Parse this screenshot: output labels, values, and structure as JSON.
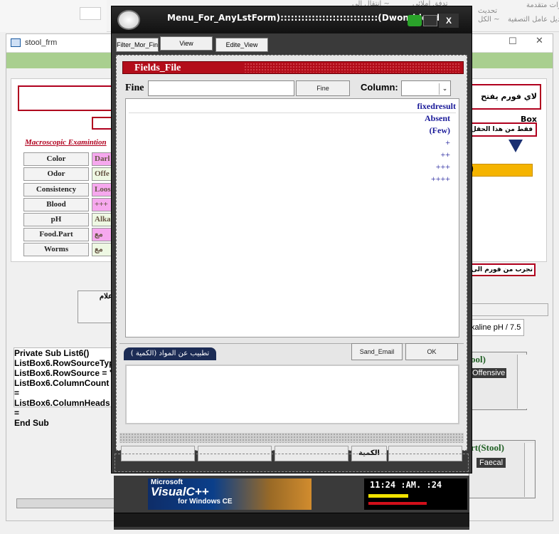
{
  "ribbon": {
    "items": [
      "ارات متقدمة ~",
      "تحديث",
      "الكل ~",
      "تدفق إملائي",
      "انتقال الى ~",
      "ديل عامل التصفية"
    ]
  },
  "stool": {
    "title": "stool_frm",
    "top_right_text": "لاي فورم يفتح Box",
    "field_note": "فقط من هذا الحقل",
    "yellow_text": ")",
    "macro_title": "Macroscopic Examintion",
    "labels": [
      "Color",
      "Odor",
      "Consistency",
      "Blood",
      "pH",
      "Food.Part",
      "Worms"
    ],
    "values": [
      "Darl",
      "Offe",
      "Loos",
      "+++",
      "Alka",
      "مع",
      "مع"
    ],
    "try_text": "تجرب من فورم الى تفر",
    "side_note": "علام",
    "code": [
      "Private Sub List6()",
      "ListBox6.RowSourceTyp",
      "ListBox6.RowSource = \"",
      "ListBox6.ColumnCount =",
      "ListBox6.ColumnHeads =",
      "End Sub"
    ],
    "alkaline": "kaline pH / 7.5",
    "stool_box_title": "ool)",
    "offensive": "Offensive",
    "part_title": "rt(Stool)",
    "faecal": "Faecal"
  },
  "menu": {
    "title": "Menu_For_AnyLstForm)::::::::::::::::::::::::::::(Dwon-blood )",
    "close_label": "X",
    "tabs": [
      "Filter_Mor_Fin",
      "View",
      "Edite_View"
    ],
    "fields_title": "Fields_File",
    "fine_label": "Fine",
    "fine_button": "Fine",
    "column_label": "Column:",
    "list_items": [
      "fixedresult",
      "Absent",
      "(Few)",
      "+",
      "++",
      "+++",
      "++++"
    ],
    "tab_title": "تطبيب عن المواد (الكمية )",
    "send_email": "Sand_Email",
    "ok": "OK",
    "bottom_label": "الكمية"
  },
  "lower": {
    "banner_line1": "Microsoft",
    "banner_line2": "VisualC++",
    "banner_line3": "for Windows CE",
    "clock": "11:24  :AM.  :24"
  }
}
